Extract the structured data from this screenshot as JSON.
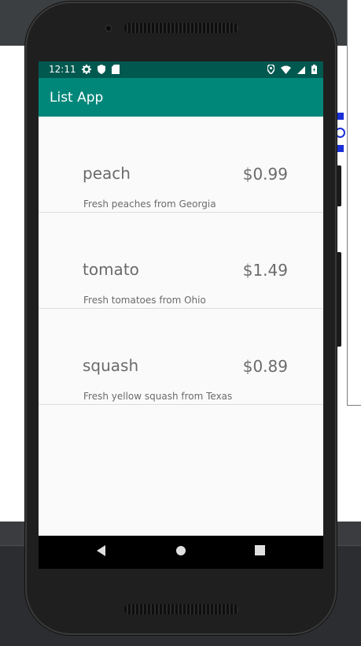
{
  "status_bar": {
    "time": "12:11"
  },
  "app_bar": {
    "title": "List App"
  },
  "items": [
    {
      "name": "peach",
      "price": "$0.99",
      "description": "Fresh peaches from Georgia"
    },
    {
      "name": "tomato",
      "price": "$1.49",
      "description": "Fresh tomatoes from Ohio"
    },
    {
      "name": "squash",
      "price": "$0.89",
      "description": "Fresh yellow squash from Texas"
    }
  ],
  "colors": {
    "status_bar": "#00584f",
    "app_bar": "#00877a",
    "screen_bg": "#fafafa",
    "text_gray": "#6b6b6b"
  },
  "icons": {
    "status_left": [
      "gear-icon",
      "shield-icon",
      "sd-card-icon"
    ],
    "status_right": [
      "location-icon",
      "wifi-icon",
      "cell-signal-icon",
      "battery-icon"
    ],
    "nav": [
      "back-icon",
      "home-icon",
      "recents-icon"
    ]
  }
}
